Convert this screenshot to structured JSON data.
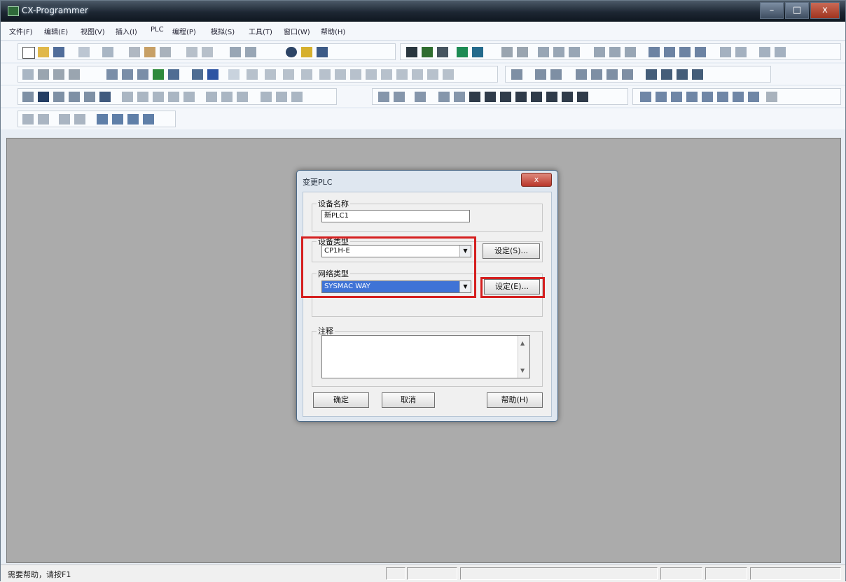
{
  "window": {
    "title": "CX-Programmer",
    "minimize_label": "–",
    "maximize_label": "□",
    "close_label": "x"
  },
  "menu": [
    {
      "label": "文件(F)"
    },
    {
      "label": "编辑(E)"
    },
    {
      "label": "视图(V)"
    },
    {
      "label": "插入(I)"
    },
    {
      "label": "PLC"
    },
    {
      "label": "编程(P)"
    },
    {
      "label": "模拟(S)"
    },
    {
      "label": "工具(T)"
    },
    {
      "label": "窗口(W)"
    },
    {
      "label": "帮助(H)"
    }
  ],
  "dialog": {
    "title": "变更PLC",
    "close_label": "x",
    "device_name_label": "设备名称",
    "device_name_value": "新PLC1",
    "device_type_label": "设备类型",
    "device_type_value": "CP1H-E",
    "device_type_settings_label": "设定(S)...",
    "network_type_label": "网络类型",
    "network_type_value": "SYSMAC WAY",
    "network_settings_label": "设定(E)...",
    "comment_label": "注释",
    "ok_label": "确定",
    "cancel_label": "取消",
    "help_label": "帮助(H)"
  },
  "status": {
    "text": "需要帮助，请按F1"
  },
  "icons": [
    "app-icon",
    "new-icon",
    "open-icon",
    "save-icon",
    "print-icon",
    "cut-icon",
    "copy-icon",
    "paste-icon",
    "undo-icon",
    "redo-icon",
    "search-icon",
    "help-icon",
    "zoom-icon",
    "ladder-icon",
    "run-icon",
    "stop-icon"
  ]
}
